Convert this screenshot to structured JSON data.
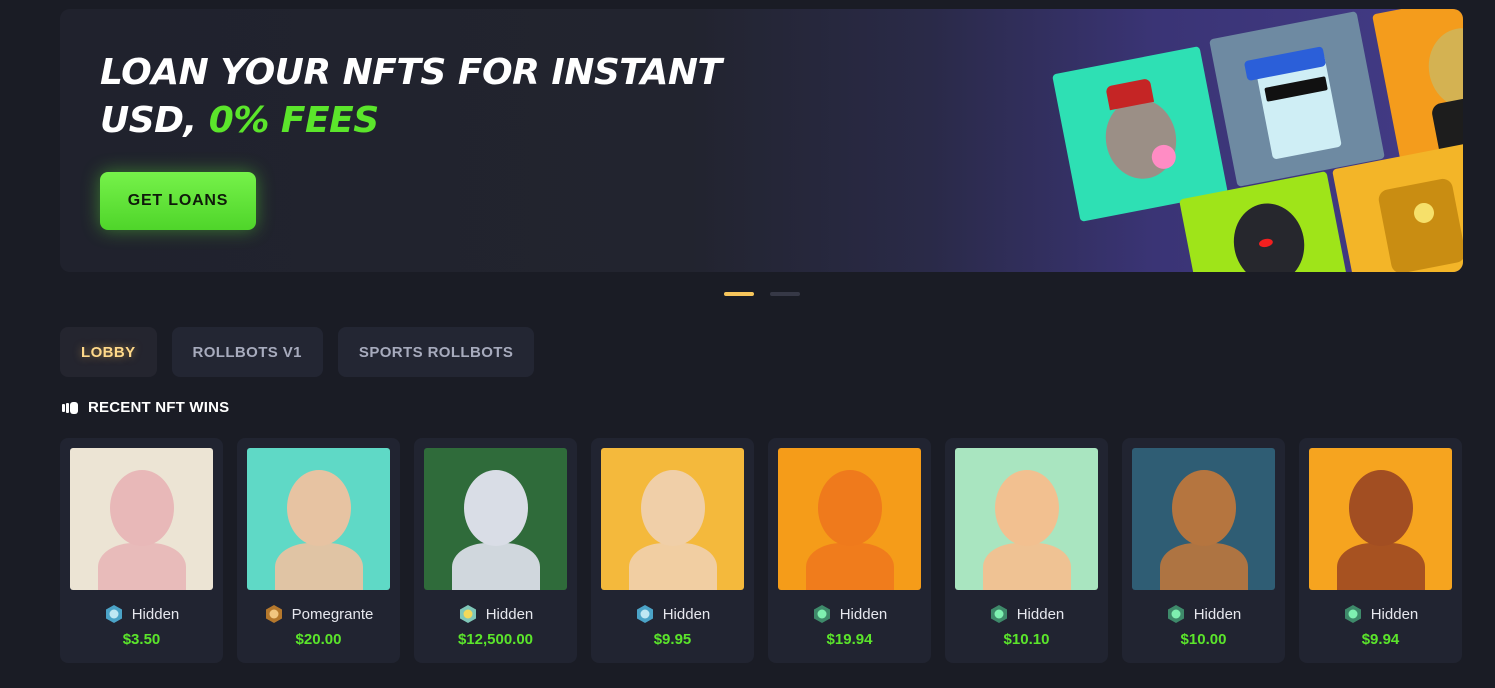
{
  "banner": {
    "title_line1": "LOAN YOUR NFTS FOR INSTANT",
    "title_line2_prefix": "USD, ",
    "title_line2_accent": "0% FEES",
    "cta_label": "GET LOANS"
  },
  "carousel": {
    "active_index": 0,
    "count": 2
  },
  "tabs": [
    {
      "label": "LOBBY",
      "active": true
    },
    {
      "label": "ROLLBOTS V1",
      "active": false
    },
    {
      "label": "SPORTS ROLLBOTS",
      "active": false
    }
  ],
  "section": {
    "title": "RECENT NFT WINS",
    "icon": "chip-icon"
  },
  "wins": [
    {
      "name": "Hidden",
      "price": "$3.50",
      "badge": "diamond-badge-icon",
      "bg": "#ece4d4",
      "fg": "#e8b8b8"
    },
    {
      "name": "Pomegrante",
      "price": "$20.00",
      "badge": "bronze-badge-icon",
      "bg": "#5fd9c6",
      "fg": "#e7c3a2"
    },
    {
      "name": "Hidden",
      "price": "$12,500.00",
      "badge": "gold-badge-icon",
      "bg": "#2f6b3a",
      "fg": "#d9dde6"
    },
    {
      "name": "Hidden",
      "price": "$9.95",
      "badge": "diamond-badge-icon",
      "bg": "#f4b93c",
      "fg": "#f0cfa8"
    },
    {
      "name": "Hidden",
      "price": "$19.94",
      "badge": "emerald-badge-icon",
      "bg": "#f59c19",
      "fg": "#ef7a1c"
    },
    {
      "name": "Hidden",
      "price": "$10.10",
      "badge": "emerald-badge-icon",
      "bg": "#a9e5c0",
      "fg": "#f2c090"
    },
    {
      "name": "Hidden",
      "price": "$10.00",
      "badge": "emerald-badge-icon",
      "bg": "#2f5d74",
      "fg": "#b5753f"
    },
    {
      "name": "Hidden",
      "price": "$9.94",
      "badge": "emerald-badge-icon",
      "bg": "#f6a41f",
      "fg": "#a24e22"
    }
  ],
  "colors": {
    "accent_green": "#5be52b",
    "background": "#1a1c25",
    "tab_active": "#ffd98a"
  }
}
